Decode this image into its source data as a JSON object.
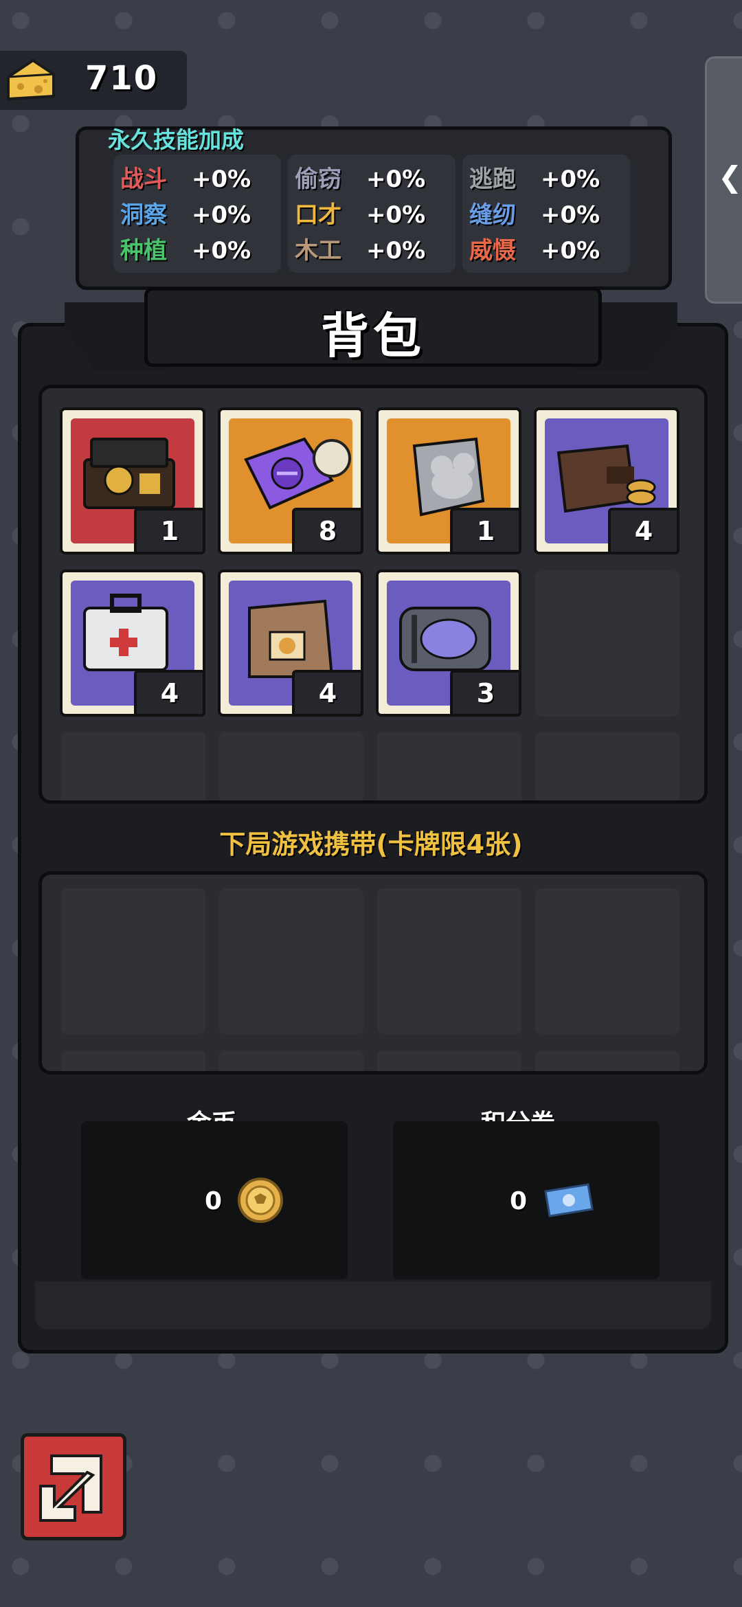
{
  "cheese": {
    "value": "710",
    "icon": "cheese-icon"
  },
  "side_tab": {
    "icon": "chevron-left-icon"
  },
  "skills": {
    "title": "永久技能加成",
    "columns": [
      [
        {
          "name": "战斗",
          "value": "+0%",
          "color": "#e35a5a"
        },
        {
          "name": "洞察",
          "value": "+0%",
          "color": "#5aa6e8"
        },
        {
          "name": "种植",
          "value": "+0%",
          "color": "#49c46a"
        }
      ],
      [
        {
          "name": "偷窃",
          "value": "+0%",
          "color": "#9b9fb8"
        },
        {
          "name": "口才",
          "value": "+0%",
          "color": "#f0b83c"
        },
        {
          "name": "木工",
          "value": "+0%",
          "color": "#b89a78"
        }
      ],
      [
        {
          "name": "逃跑",
          "value": "+0%",
          "color": "#a0a3a8"
        },
        {
          "name": "缝纫",
          "value": "+0%",
          "color": "#6a9ee8"
        },
        {
          "name": "威慑",
          "value": "+0%",
          "color": "#e8684a"
        }
      ]
    ]
  },
  "bag": {
    "title": "背包",
    "items": [
      {
        "name": "gift-box-card",
        "count": "1",
        "bg": "#c23b40"
      },
      {
        "name": "purple-gem-card",
        "count": "8",
        "bg": "#e0902c"
      },
      {
        "name": "mouse-idol-card",
        "count": "1",
        "bg": "#e0902c"
      },
      {
        "name": "wallet-card",
        "count": "4",
        "bg": "#6b5cc0"
      },
      {
        "name": "first-aid-card",
        "count": "4",
        "bg": "#6b5cc0"
      },
      {
        "name": "cheese-bag-card",
        "count": "4",
        "bg": "#6b5cc0"
      },
      {
        "name": "brain-jar-card",
        "count": "3",
        "bg": "#6b5cc0"
      }
    ]
  },
  "carry": {
    "label": "下局游戏携带(卡牌限4张)"
  },
  "currency": {
    "gold": {
      "label": "金币",
      "value": "0",
      "icon": "gold-coin-icon"
    },
    "points": {
      "label": "积分券",
      "value": "0",
      "icon": "ticket-icon"
    }
  },
  "back_button": {
    "icon": "exit-arrow-icon"
  }
}
